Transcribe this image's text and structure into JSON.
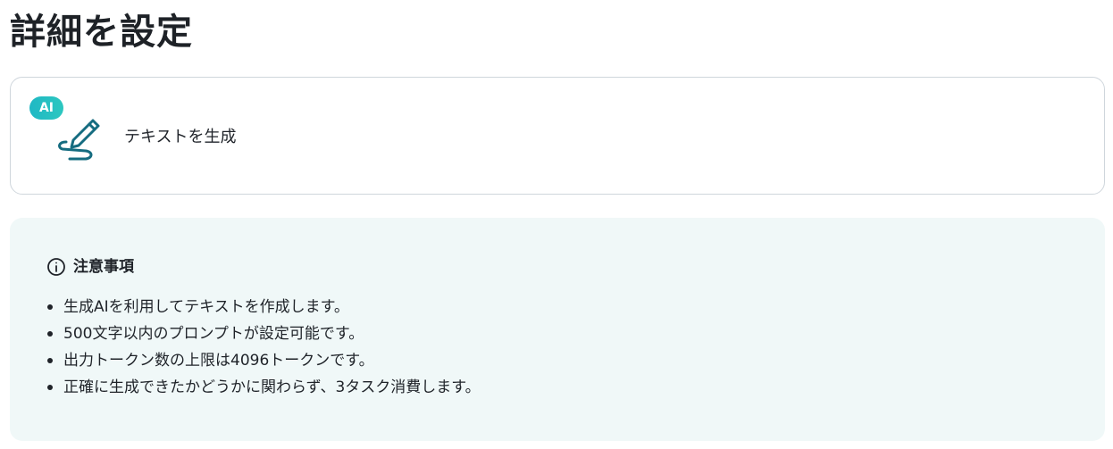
{
  "page": {
    "title": "詳細を設定"
  },
  "action": {
    "badge": "AI",
    "icon": "pen-signature-icon",
    "label": "テキストを生成",
    "accent_color": "#1fb8c4",
    "icon_color": "#156c80"
  },
  "notice": {
    "icon": "info-circle-icon",
    "title": "注意事項",
    "background": "#f0f8f8",
    "items": [
      "生成AIを利用してテキストを作成します。",
      "500文字以内のプロンプトが設定可能です。",
      "出力トークン数の上限は4096トークンです。",
      "正確に生成できたかどうかに関わらず、3タスク消費します。"
    ]
  }
}
